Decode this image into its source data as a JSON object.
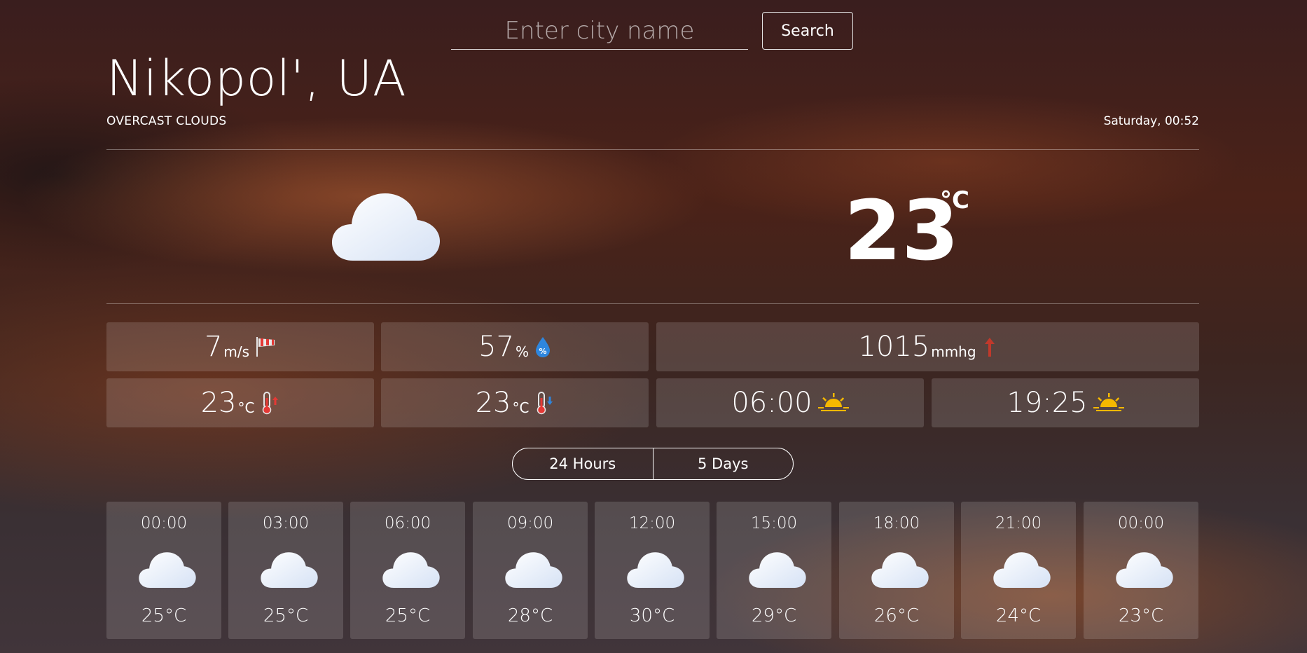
{
  "search": {
    "placeholder": "Enter city name",
    "value": "",
    "button_label": "Search"
  },
  "location": {
    "title": "Nikopol', UA",
    "condition": "OVERCAST CLOUDS",
    "datetime": "Saturday, 00:52"
  },
  "current": {
    "icon": "cloud-icon",
    "temperature": "23",
    "unit": "°C"
  },
  "stats": {
    "wind": {
      "value": "7",
      "unit": "m/s",
      "icon": "windsock-icon"
    },
    "humidity": {
      "value": "57",
      "unit": "%",
      "icon": "humidity-drop-icon"
    },
    "pressure": {
      "value": "1015",
      "unit": "mmhg",
      "icon": "arrow-up-icon"
    },
    "temp_max": {
      "value": "23",
      "unit": "°C",
      "icon": "thermometer-up-icon"
    },
    "temp_min": {
      "value": "23",
      "unit": "°C",
      "icon": "thermometer-down-icon"
    },
    "sunrise": {
      "value": "06:00",
      "icon": "sunrise-icon"
    },
    "sunset": {
      "value": "19:25",
      "icon": "sunset-icon"
    }
  },
  "tabs": [
    {
      "label": "24 Hours"
    },
    {
      "label": "5 Days"
    }
  ],
  "forecast": [
    {
      "time": "00:00",
      "temp": "25°C",
      "icon": "cloud-icon"
    },
    {
      "time": "03:00",
      "temp": "25°C",
      "icon": "cloud-icon"
    },
    {
      "time": "06:00",
      "temp": "25°C",
      "icon": "cloud-icon"
    },
    {
      "time": "09:00",
      "temp": "28°C",
      "icon": "cloud-icon"
    },
    {
      "time": "12:00",
      "temp": "30°C",
      "icon": "cloud-icon"
    },
    {
      "time": "15:00",
      "temp": "29°C",
      "icon": "cloud-icon"
    },
    {
      "time": "18:00",
      "temp": "26°C",
      "icon": "cloud-icon"
    },
    {
      "time": "21:00",
      "temp": "24°C",
      "icon": "cloud-icon"
    },
    {
      "time": "00:00",
      "temp": "23°C",
      "icon": "cloud-icon"
    }
  ],
  "colors": {
    "pressure_arrow": "#c0392b",
    "humidity_drop": "#2e86de",
    "sun": "#f5b800"
  }
}
